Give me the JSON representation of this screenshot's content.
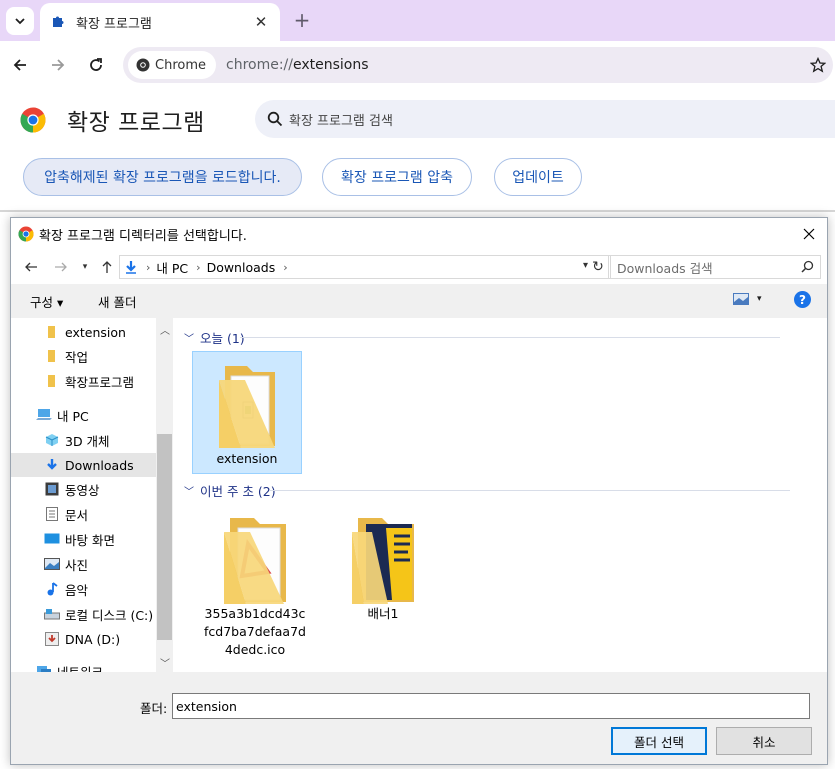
{
  "browser": {
    "tab_title": "확장 프로그램",
    "chip_label": "Chrome",
    "url_path": "chrome://extensions"
  },
  "page": {
    "title": "확장 프로그램",
    "search_placeholder": "확장 프로그램 검색",
    "buttons": {
      "load_unpacked": "압축해제된 확장 프로그램을 로드합니다.",
      "pack": "확장 프로그램 압축",
      "update": "업데이트"
    }
  },
  "dialog": {
    "title": "확장 프로그램 디렉터리를 선택합니다.",
    "breadcrumb": [
      "내 PC",
      "Downloads"
    ],
    "search_placeholder": "Downloads 검색",
    "commands": {
      "organize": "구성 ▾",
      "new_folder": "새 폴더"
    },
    "nav_items": [
      {
        "label": "extension",
        "icon": "folder-icon"
      },
      {
        "label": "작업",
        "icon": "folder-icon"
      },
      {
        "label": "확장프로그램",
        "icon": "folder-icon"
      },
      {
        "label": "내 PC",
        "icon": "computer-icon"
      },
      {
        "label": "3D 개체",
        "icon": "3d-objects-icon"
      },
      {
        "label": "Downloads",
        "icon": "download-arrow-icon",
        "selected": true
      },
      {
        "label": "동영상",
        "icon": "video-icon"
      },
      {
        "label": "문서",
        "icon": "document-icon"
      },
      {
        "label": "바탕 화면",
        "icon": "desktop-icon"
      },
      {
        "label": "사진",
        "icon": "pictures-icon"
      },
      {
        "label": "음악",
        "icon": "music-icon"
      },
      {
        "label": "로컬 디스크 (C:)",
        "icon": "drive-icon"
      },
      {
        "label": "DNA (D:)",
        "icon": "drive-icon"
      },
      {
        "label": "네트워크",
        "icon": "network-icon"
      }
    ],
    "groups": [
      {
        "header": "오늘 (1)",
        "files": [
          {
            "name": "extension",
            "selected": true
          }
        ]
      },
      {
        "header": "이번 주 초 (2)",
        "files": [
          {
            "name": "355a3b1dcd43cfcd7ba7defaa7d4dedc.ico"
          },
          {
            "name": "배너1"
          }
        ]
      }
    ],
    "folder_label": "폴더:",
    "folder_value": "extension",
    "select_button": "폴더 선택",
    "cancel_button": "취소"
  },
  "colors": {
    "tabstrip": "#e8d7f8",
    "link_blue": "#1a57b6",
    "selection": "#cce8ff",
    "folder_yellow": "#f5cf66"
  }
}
